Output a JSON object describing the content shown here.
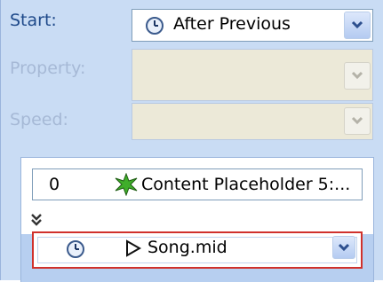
{
  "start": {
    "label": "Start:",
    "value": "After Previous"
  },
  "property": {
    "label": "Property:"
  },
  "speed": {
    "label": "Speed:"
  },
  "list": {
    "item1": {
      "order": "0",
      "name": "Content Placeholder 5:..."
    },
    "effect": {
      "name": "Song.mid"
    }
  },
  "icons": {
    "timing": "clock-icon",
    "effect_type": "star-burst-icon",
    "play": "play-triangle-icon",
    "expand": "double-chevron-down-icon",
    "dropdown": "chevron-down-icon"
  },
  "colors": {
    "accent": "#1f4a8a",
    "highlight_border": "#d0312c"
  }
}
